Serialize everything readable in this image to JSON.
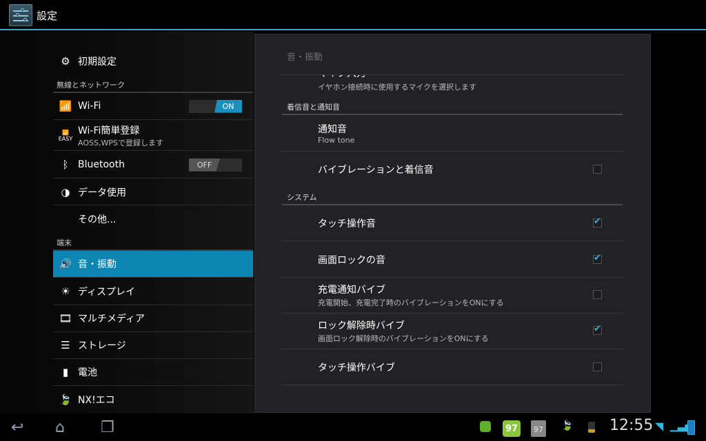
{
  "app": {
    "title": "設定"
  },
  "sidebar": {
    "top_item": "初期設定",
    "section_network": "無線とネットワーク",
    "wifi": {
      "label": "Wi-Fi",
      "toggle": "ON"
    },
    "wifi_easy": {
      "label": "Wi-Fi簡単登録",
      "sub": "AOSS,WPSで登録します",
      "badge": "EASY"
    },
    "bluetooth": {
      "label": "Bluetooth",
      "toggle": "OFF"
    },
    "data_usage": "データ使用",
    "more": "その他...",
    "section_device": "端末",
    "sound": "音・振動",
    "display": "ディスプレイ",
    "multimedia": "マルチメディア",
    "storage": "ストレージ",
    "battery": "電池",
    "eco": "NX!エコ"
  },
  "main": {
    "title": "音・振動",
    "clipped_item": {
      "title": "マイク入力",
      "sub": "イヤホン接続時に使用するマイクを選択します"
    },
    "section_ring": "着信音と通知音",
    "notification": {
      "title": "通知音",
      "sub": "Flow tone"
    },
    "vibrate_ring": {
      "title": "バイブレーションと着信音",
      "checked": false
    },
    "section_system": "システム",
    "touch_sound": {
      "title": "タッチ操作音",
      "checked": true
    },
    "lock_sound": {
      "title": "画面ロックの音",
      "checked": true
    },
    "charge_vibe": {
      "title": "充電通知バイブ",
      "sub": "充電開始、充電完了時のバイブレーションをONにする",
      "checked": false
    },
    "unlock_vibe": {
      "title": "ロック解除時バイブ",
      "sub": "画面ロック解除時のバイブレーションをONにする",
      "checked": true
    },
    "touch_vibe": {
      "title": "タッチ操作バイブ",
      "checked": false
    }
  },
  "statusbar": {
    "time": "12:55",
    "badge1": "97",
    "badge2": "97"
  },
  "colors": {
    "accent": "#0d85b2",
    "check": "#33b5e5"
  }
}
